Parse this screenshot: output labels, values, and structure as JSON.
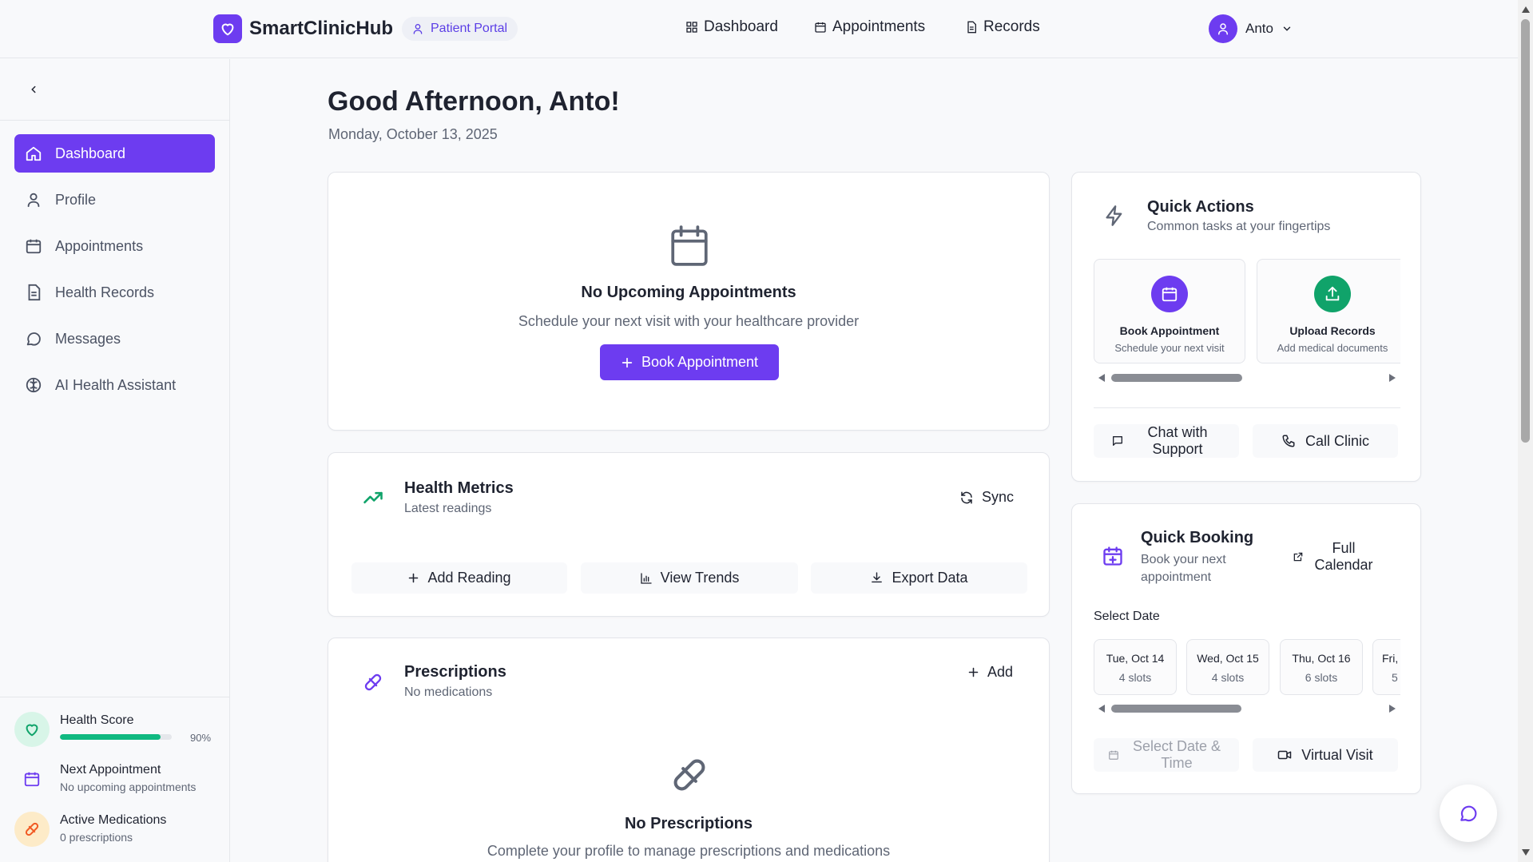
{
  "header": {
    "brand": "SmartClinicHub",
    "portal_badge": "Patient Portal",
    "nav": [
      {
        "label": "Dashboard",
        "icon": "grid-icon"
      },
      {
        "label": "Appointments",
        "icon": "calendar-icon"
      },
      {
        "label": "Records",
        "icon": "document-icon"
      }
    ],
    "user_name": "Anto"
  },
  "sidebar": {
    "items": [
      {
        "label": "Dashboard",
        "icon": "home-icon",
        "active": true
      },
      {
        "label": "Profile",
        "icon": "user-icon"
      },
      {
        "label": "Appointments",
        "icon": "calendar-icon"
      },
      {
        "label": "Health Records",
        "icon": "document-icon"
      },
      {
        "label": "Messages",
        "icon": "message-icon"
      },
      {
        "label": "AI Health Assistant",
        "icon": "brain-icon"
      }
    ],
    "health_score": {
      "label": "Health Score",
      "value": 90,
      "value_text": "90%"
    },
    "next_appointment": {
      "label": "Next Appointment",
      "sub": "No upcoming appointments"
    },
    "active_medications": {
      "label": "Active Medications",
      "sub": "0 prescriptions"
    }
  },
  "main": {
    "greeting": "Good Afternoon, Anto!",
    "date": "Monday, October 13, 2025",
    "appointments_card": {
      "title": "No Upcoming Appointments",
      "subtitle": "Schedule your next visit with your healthcare provider",
      "button": "Book Appointment"
    },
    "health_metrics": {
      "title": "Health Metrics",
      "subtitle": "Latest readings",
      "sync": "Sync",
      "actions": [
        "Add Reading",
        "View Trends",
        "Export Data"
      ]
    },
    "prescriptions": {
      "title": "Prescriptions",
      "subtitle": "No medications",
      "add": "Add",
      "empty_title": "No Prescriptions",
      "empty_sub": "Complete your profile to manage prescriptions and medications"
    }
  },
  "quick_actions": {
    "title": "Quick Actions",
    "subtitle": "Common tasks at your fingertips",
    "tiles": [
      {
        "title": "Book Appointment",
        "sub": "Schedule your next visit",
        "color": "#6d3cf0"
      },
      {
        "title": "Upload Records",
        "sub": "Add medical documents",
        "color": "#10a36a"
      }
    ],
    "chat_support": "Chat with Support",
    "call_clinic": "Call Clinic"
  },
  "quick_booking": {
    "title": "Quick Booking",
    "subtitle": "Book your next appointment",
    "full_calendar": "Full Calendar",
    "select_date_label": "Select Date",
    "dates": [
      {
        "day": "Tue, Oct 14",
        "slots": "4 slots"
      },
      {
        "day": "Wed, Oct 15",
        "slots": "4 slots"
      },
      {
        "day": "Thu, Oct 16",
        "slots": "6 slots"
      },
      {
        "day": "Fri,",
        "slots": "5"
      }
    ],
    "select_date_time": "Select Date & Time",
    "virtual_visit": "Virtual Visit"
  },
  "colors": {
    "accent": "#6d3cf0",
    "success": "#10b981",
    "text": "#1f2330",
    "muted": "#5f6675"
  }
}
